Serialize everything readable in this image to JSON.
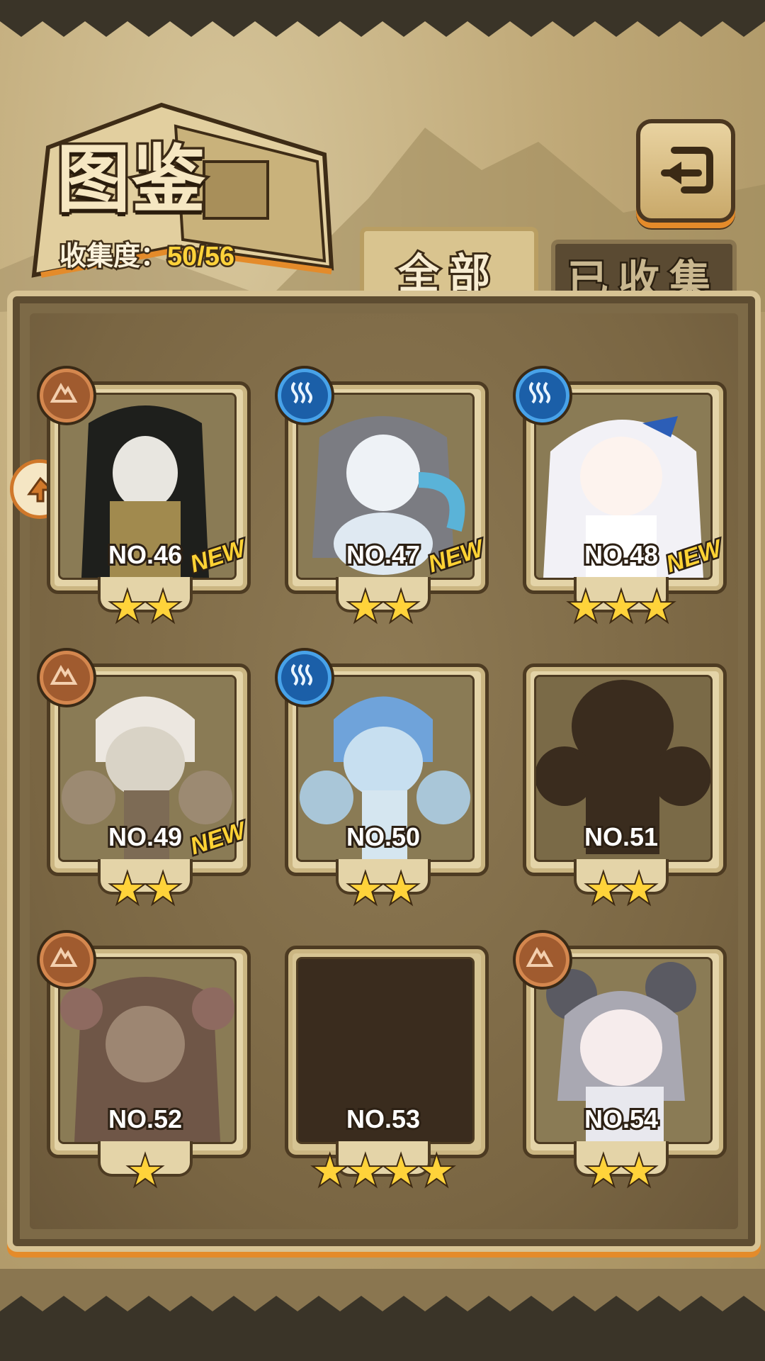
{
  "header": {
    "title": "图鉴",
    "collection_label": "收集度：",
    "collection_value": "50/56"
  },
  "tabs": [
    {
      "label": "全部",
      "active": true
    },
    {
      "label": "已收集",
      "active": false
    }
  ],
  "cards": [
    {
      "number": "NO.46",
      "stars": "★★",
      "new": "NEW",
      "element": "earth",
      "locked": false
    },
    {
      "number": "NO.47",
      "stars": "★★",
      "new": "NEW",
      "element": "water",
      "locked": false
    },
    {
      "number": "NO.48",
      "stars": "★★★",
      "new": "NEW",
      "element": "water",
      "locked": false
    },
    {
      "number": "NO.49",
      "stars": "★★",
      "new": "NEW",
      "element": "earth",
      "locked": false
    },
    {
      "number": "NO.50",
      "stars": "★★",
      "new": "",
      "element": "water",
      "locked": false
    },
    {
      "number": "NO.51",
      "stars": "★★",
      "new": "",
      "element": "",
      "locked": true
    },
    {
      "number": "NO.52",
      "stars": "★",
      "new": "",
      "element": "earth",
      "locked": false
    },
    {
      "number": "NO.53",
      "stars": "★★★★",
      "new": "",
      "element": "",
      "locked": true
    },
    {
      "number": "NO.54",
      "stars": "★★",
      "new": "",
      "element": "earth",
      "locked": false
    }
  ],
  "colors": {
    "accent_orange": "#e48b2a",
    "gold_text": "#ffd23a",
    "earth_badge": "#a05b2f",
    "water_badge": "#1b5fa8"
  },
  "icons": {
    "back": "return-arrow-icon",
    "earth": "mountain-icon",
    "water": "wave-icon",
    "side": "arrow-tab-icon"
  }
}
